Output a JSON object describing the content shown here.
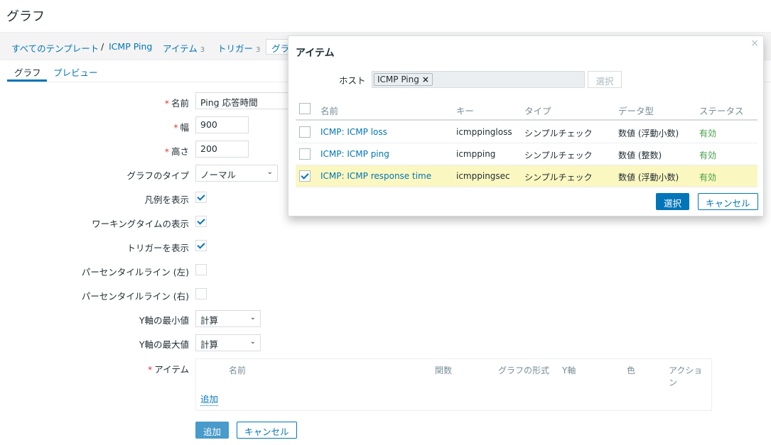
{
  "page": {
    "title": "グラフ"
  },
  "nav": {
    "all_templates": "すべてのテンプレート",
    "separator": "/",
    "template": "ICMP Ping",
    "items": "アイテム",
    "items_count": "3",
    "triggers": "トリガー",
    "triggers_count": "3",
    "graphs_partial": "グラフ"
  },
  "tabs": {
    "graph": "グラフ",
    "preview": "プレビュー"
  },
  "form": {
    "name_label": "名前",
    "name_value": "Ping 応答時間",
    "width_label": "幅",
    "width_value": "900",
    "height_label": "高さ",
    "height_value": "200",
    "graph_type_label": "グラフのタイプ",
    "graph_type_value": "ノーマル",
    "show_legend_label": "凡例を表示",
    "show_legend": true,
    "show_working_time_label": "ワーキングタイムの表示",
    "show_working_time": true,
    "show_triggers_label": "トリガーを表示",
    "show_triggers": true,
    "percentile_left_label": "パーセンタイルライン (左)",
    "percentile_left": false,
    "percentile_right_label": "パーセンタイルライン (右)",
    "percentile_right": false,
    "y_min_label": "Y軸の最小値",
    "y_min_value": "計算",
    "y_max_label": "Y軸の最大値",
    "y_max_value": "計算",
    "items_label": "アイテム",
    "items_columns": {
      "name": "名前",
      "function": "関数",
      "draw_style": "グラフの形式",
      "y_axis": "Y軸",
      "color": "色",
      "action_1": "アクショ",
      "action_2": "ン"
    },
    "items_add_link": "追加",
    "add_button": "追加",
    "cancel_button": "キャンセル"
  },
  "modal": {
    "title": "アイテム",
    "close_icon": "×",
    "host_label": "ホスト",
    "host_tag": "ICMP Ping",
    "host_tag_remove": "×",
    "host_select_button": "選択",
    "columns": {
      "name": "名前",
      "key": "キー",
      "type": "タイプ",
      "data_type": "データ型",
      "status": "ステータス"
    },
    "rows": [
      {
        "name": "ICMP: ICMP loss",
        "key": "icmppingloss",
        "type": "シンプルチェック",
        "data_type": "数値 (浮動小数)",
        "status": "有効",
        "checked": false
      },
      {
        "name": "ICMP: ICMP ping",
        "key": "icmpping",
        "type": "シンプルチェック",
        "data_type": "数値 (整数)",
        "status": "有効",
        "checked": false
      },
      {
        "name": "ICMP: ICMP response time",
        "key": "icmppingsec",
        "type": "シンプルチェック",
        "data_type": "数値 (浮動小数)",
        "status": "有効",
        "checked": true
      }
    ],
    "select_button": "選択",
    "cancel_button": "キャンセル"
  },
  "colors": {
    "link": "#0275b8",
    "required": "#e33734",
    "enabled": "#429e47",
    "selected_row": "#fbf7c0"
  }
}
